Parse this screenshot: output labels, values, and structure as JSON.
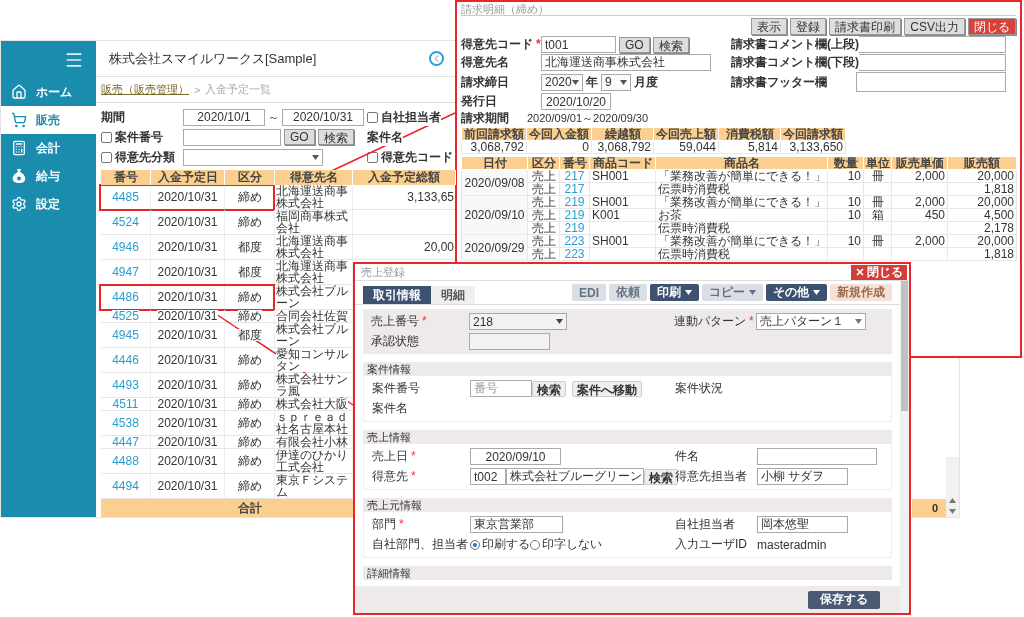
{
  "main_window": {
    "sidebar": {
      "items": [
        {
          "label": "ホーム",
          "selected": false
        },
        {
          "label": "販売",
          "selected": true
        },
        {
          "label": "会計",
          "selected": false
        },
        {
          "label": "給与",
          "selected": false
        },
        {
          "label": "設定",
          "selected": false
        }
      ]
    },
    "title": "株式会社スマイルワークス[Sample]",
    "breadcrumb": {
      "link": "販売（販売管理）",
      "separator": ">",
      "current": "入金予定一覧"
    },
    "filters": {
      "period": {
        "label": "期間",
        "from": "2020/10/1",
        "separator": "～",
        "to": "2020/10/31"
      },
      "own_staff": {
        "label": "自社担当者",
        "checked": false
      },
      "project_no": {
        "label": "案件番号",
        "checked": false,
        "go": "GO",
        "search": "検索"
      },
      "project_name": {
        "label": "案件名"
      },
      "customer_class": {
        "label": "得意先分類",
        "checked": false
      },
      "customer_code": {
        "label": "得意先コード",
        "checked": false
      }
    },
    "table": {
      "columns": [
        "番号",
        "入金予定日",
        "区分",
        "得意先名",
        "入金予定総額"
      ],
      "rows": [
        {
          "number": "4485",
          "date": "2020/10/31",
          "type": "締め",
          "customer": "北海運送商事株式会社",
          "amount": "3,133,65",
          "highlighted": true
        },
        {
          "number": "4524",
          "date": "2020/10/31",
          "type": "締め",
          "customer": "福岡商事株式会社",
          "highlighted": false
        },
        {
          "number": "4946",
          "date": "2020/10/31",
          "type": "都度",
          "customer": "北海運送商事株式会社",
          "amount": "20,00",
          "highlighted": false
        },
        {
          "number": "4947",
          "date": "2020/10/31",
          "type": "都度",
          "customer": "北海運送商事株式会社",
          "highlighted": false
        },
        {
          "number": "4486",
          "date": "2020/10/31",
          "type": "締め",
          "customer": "株式会社ブルーン",
          "highlighted": true
        },
        {
          "number": "4525",
          "date": "2020/10/31",
          "type": "締め",
          "customer": "合同会社佐賀",
          "highlighted": false
        },
        {
          "number": "4945",
          "date": "2020/10/31",
          "type": "都度",
          "customer": "株式会社ブルーン",
          "highlighted": false
        },
        {
          "number": "4446",
          "date": "2020/10/31",
          "type": "締め",
          "customer": "愛知コンサルタン",
          "highlighted": false
        },
        {
          "number": "4493",
          "date": "2020/10/31",
          "type": "締め",
          "customer": "株式会社サンラ風",
          "highlighted": false
        },
        {
          "number": "4511",
          "date": "2020/10/31",
          "type": "締め",
          "customer": "株式会社大阪",
          "highlighted": false
        },
        {
          "number": "4538",
          "date": "2020/10/31",
          "type": "締め",
          "customer": "ｓｐｒｅａｄ社名古屋本社",
          "highlighted": false
        },
        {
          "number": "4447",
          "date": "2020/10/31",
          "type": "締め",
          "customer": "有限会社小林",
          "highlighted": false
        },
        {
          "number": "4488",
          "date": "2020/10/31",
          "type": "締め",
          "customer": "伊達のひかり工式会社",
          "highlighted": false
        },
        {
          "number": "4494",
          "date": "2020/10/31",
          "type": "締め",
          "customer": "東京Ｆシステム",
          "highlighted": false
        }
      ],
      "footer": {
        "label": "合計",
        "total": "0"
      }
    }
  },
  "invoice_window": {
    "title": "請求明細（締め）",
    "buttons": [
      {
        "label": "表示",
        "kind": "normal"
      },
      {
        "label": "登録",
        "kind": "normal"
      },
      {
        "label": "請求書印刷",
        "kind": "normal"
      },
      {
        "label": "CSV出力",
        "kind": "normal"
      },
      {
        "label": "閉じる",
        "kind": "danger"
      }
    ],
    "customer_code": {
      "label": "得意先コード",
      "required_mark": "*",
      "value": "t001",
      "go": "GO",
      "search": "検索"
    },
    "customer_name": {
      "label": "得意先名",
      "value": "北海運送商事株式会社"
    },
    "closing": {
      "label": "請求締日",
      "year": "2020",
      "year_unit": "年",
      "month": "9",
      "month_unit": "月度"
    },
    "issue_date": {
      "label": "発行日",
      "value": "2020/10/20"
    },
    "comment_upper": {
      "label": "請求書コメント欄(上段)"
    },
    "comment_lower": {
      "label": "請求書コメント欄(下段)"
    },
    "footer_note": {
      "label": "請求書フッター欄"
    },
    "period": {
      "label": "請求期間",
      "value": "2020/09/01～2020/09/30"
    },
    "summary": {
      "columns": [
        "前回請求額",
        "今回入金額",
        "繰越額",
        "今回売上額",
        "消費税額",
        "今回請求額"
      ],
      "values": [
        "3,068,792",
        "0",
        "3,068,792",
        "59,044",
        "5,814",
        "3,133,650"
      ]
    },
    "details": {
      "columns": [
        "日付",
        "区分",
        "番号",
        "商品コード",
        "商品名",
        "数量",
        "単位",
        "販売単価",
        "販売額"
      ],
      "groups": [
        {
          "date": "2020/09/08",
          "lines": [
            {
              "type": "売上",
              "number": "217",
              "code": "SH001",
              "name": "「業務改善が簡単にできる！」",
              "qty": "10",
              "unit": "冊",
              "price": "2,000",
              "amount": "20,000"
            },
            {
              "type": "売上",
              "number": "217",
              "name": "伝票時消費税",
              "amount": "1,818"
            }
          ]
        },
        {
          "date": "2020/09/10",
          "lines": [
            {
              "type": "売上",
              "number": "219",
              "code": "SH001",
              "name": "「業務改善が簡単にできる！」",
              "qty": "10",
              "unit": "冊",
              "price": "2,000",
              "amount": "20,000"
            },
            {
              "type": "売上",
              "number": "219",
              "code": "K001",
              "name": "お茶",
              "qty": "10",
              "unit": "箱",
              "price": "450",
              "amount": "4,500"
            },
            {
              "type": "売上",
              "number": "219",
              "name": "伝票時消費税",
              "amount": "2,178"
            }
          ]
        },
        {
          "date": "2020/09/29",
          "lines": [
            {
              "type": "売上",
              "number": "223",
              "code": "SH001",
              "name": "「業務改善が簡単にできる！」",
              "qty": "10",
              "unit": "冊",
              "price": "2,000",
              "amount": "20,000"
            },
            {
              "type": "売上",
              "number": "223",
              "name": "伝票時消費税",
              "amount": "1,818"
            }
          ]
        }
      ]
    }
  },
  "sales_window": {
    "title": "売上登録",
    "close": "閉じる",
    "tabs": [
      {
        "label": "取引情報",
        "selected": true
      },
      {
        "label": "明細",
        "selected": false
      }
    ],
    "actions": [
      {
        "label": "EDI",
        "kind": "plain",
        "disabled": true
      },
      {
        "label": "依頼",
        "kind": "plain",
        "disabled": true
      },
      {
        "label": "印刷",
        "kind": "menu",
        "disabled": false
      },
      {
        "label": "コピー",
        "kind": "menu",
        "disabled": true
      },
      {
        "label": "その他",
        "kind": "menu",
        "disabled": false
      },
      {
        "label": "新規作成",
        "kind": "create",
        "disabled": true
      }
    ],
    "sales_no": {
      "label": "売上番号",
      "required_mark": "*",
      "value": "218"
    },
    "pattern": {
      "label": "連動パターン",
      "required_mark": "*",
      "value": "売上パターン１"
    },
    "approval": {
      "label": "承認状態"
    },
    "project": {
      "title": "案件情報",
      "number": {
        "label": "案件番号",
        "placeholder": "番号",
        "search": "検索",
        "move": "案件へ移動"
      },
      "status": {
        "label": "案件状況"
      },
      "name": {
        "label": "案件名"
      }
    },
    "sales": {
      "title": "売上情報",
      "date": {
        "label": "売上日",
        "required_mark": "*",
        "value": "2020/09/10"
      },
      "subject": {
        "label": "件名"
      },
      "customer": {
        "label": "得意先",
        "required_mark": "*",
        "code": "t002",
        "name": "株式会社ブルーグリーン",
        "search": "検索"
      },
      "contact": {
        "label": "得意先担当者",
        "value": "小柳 サダヲ"
      }
    },
    "origin": {
      "title": "売上元情報",
      "department": {
        "label": "部門",
        "required_mark": "*",
        "value": "東京営業部"
      },
      "staff": {
        "label": "自社担当者",
        "value": "岡本悠聖"
      },
      "print": {
        "label": "自社部門、担当者",
        "options": [
          {
            "label": "印刷する",
            "selected": true
          },
          {
            "label": "印字しない",
            "selected": false
          }
        ]
      },
      "user": {
        "label": "入力ユーザID",
        "value": "masteradmin"
      }
    },
    "detail": {
      "title": "詳細情報"
    },
    "save": "保存する"
  }
}
